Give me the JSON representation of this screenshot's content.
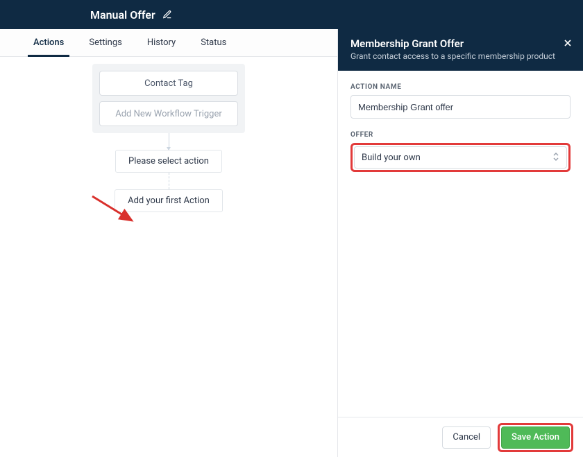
{
  "topbar": {
    "title": "Manual Offer"
  },
  "tabs": [
    "Actions",
    "Settings",
    "History",
    "Status"
  ],
  "active_tab": 0,
  "triggers": {
    "existing": "Contact Tag",
    "add_label": "Add New Workflow Trigger"
  },
  "flow": {
    "select_action": "Please select action",
    "first_action": "Add your first Action"
  },
  "panel": {
    "title": "Membership Grant Offer",
    "subtitle": "Grant contact access to a specific membership product",
    "action_name_label": "ACTION NAME",
    "action_name_value": "Membership Grant offer",
    "offer_label": "OFFER",
    "offer_value": "Build your own",
    "cancel": "Cancel",
    "save": "Save Action"
  }
}
